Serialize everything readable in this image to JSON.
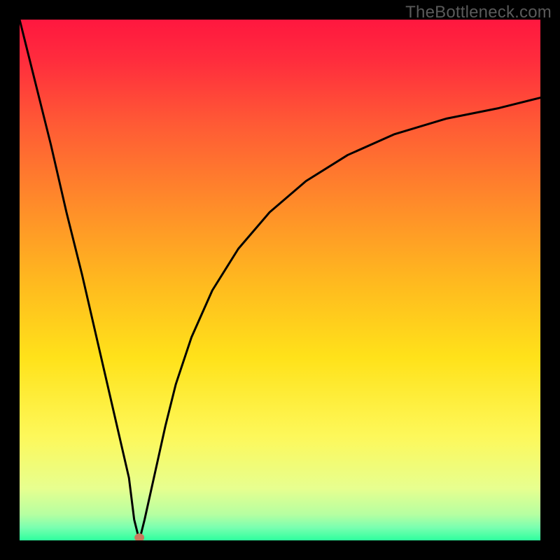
{
  "watermark": "TheBottleneck.com",
  "colors": {
    "frame_background": "#000000",
    "gradient_stops": [
      {
        "offset": 0.0,
        "hex": "#ff173f"
      },
      {
        "offset": 0.08,
        "hex": "#ff2d3d"
      },
      {
        "offset": 0.2,
        "hex": "#ff5a35"
      },
      {
        "offset": 0.35,
        "hex": "#ff8a2a"
      },
      {
        "offset": 0.5,
        "hex": "#ffb81f"
      },
      {
        "offset": 0.65,
        "hex": "#ffe21a"
      },
      {
        "offset": 0.8,
        "hex": "#fdf85a"
      },
      {
        "offset": 0.9,
        "hex": "#e7ff8f"
      },
      {
        "offset": 0.95,
        "hex": "#b6ffa1"
      },
      {
        "offset": 0.975,
        "hex": "#7affb0"
      },
      {
        "offset": 1.0,
        "hex": "#2eff9e"
      }
    ],
    "curve_stroke": "#000000",
    "marker_fill": "#c77a5e"
  },
  "chart_data": {
    "type": "line",
    "title": "",
    "xlabel": "",
    "ylabel": "",
    "xlim": [
      0,
      100
    ],
    "ylim": [
      0,
      100
    ],
    "grid": false,
    "series": [
      {
        "name": "bottleneck-curve",
        "x": [
          0,
          3,
          6,
          9,
          12,
          15,
          18,
          21,
          22,
          23,
          24,
          26,
          28,
          30,
          33,
          37,
          42,
          48,
          55,
          63,
          72,
          82,
          92,
          100
        ],
        "y": [
          100,
          88,
          76,
          63,
          51,
          38,
          25,
          12,
          4,
          0,
          4,
          13,
          22,
          30,
          39,
          48,
          56,
          63,
          69,
          74,
          78,
          81,
          83,
          85
        ]
      }
    ],
    "marker": {
      "x": 23,
      "y": 0,
      "label": "optimum-point"
    }
  }
}
